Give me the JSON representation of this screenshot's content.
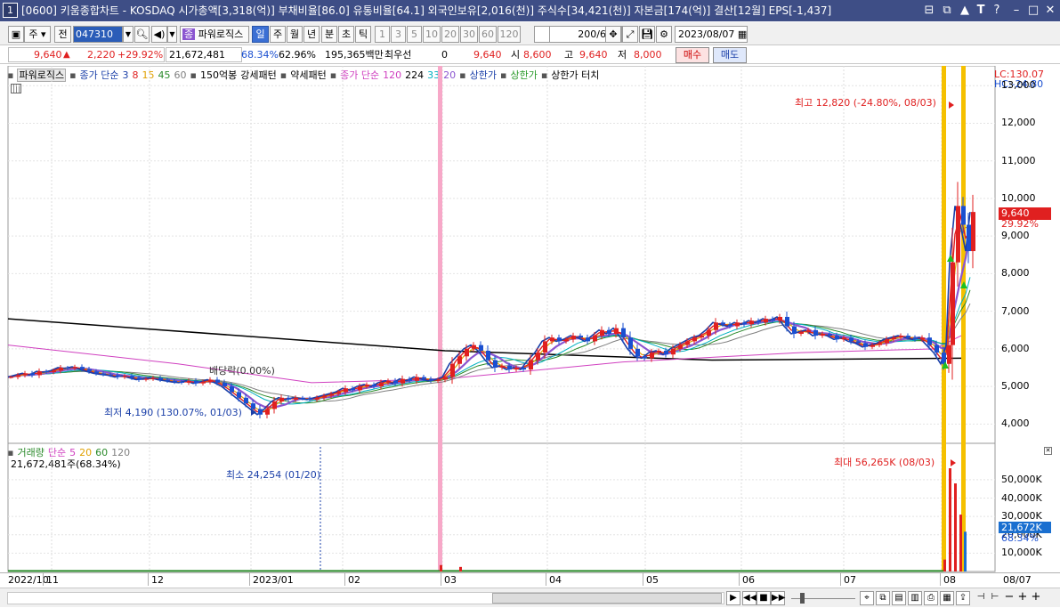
{
  "window": {
    "num": "1",
    "title": "[0600] 키움종합차트 - KOSDAQ 시가총액[3,318(억)] 부채비율[86.0] 유통비율[64.1] 외국인보유[2,016(천)] 주식수[34,421(천)] 자본금[174(억)] 결산[12월] EPS[-1,437]"
  },
  "toolbar": {
    "type_select": "주",
    "prev_label": "전",
    "code_value": "047310",
    "indicator_label": "파워로직스",
    "periods": [
      "일",
      "주",
      "월",
      "년",
      "분",
      "초",
      "틱"
    ],
    "intervals": [
      "1",
      "3",
      "5",
      "10",
      "20",
      "30",
      "60",
      "120"
    ],
    "count": "200",
    "count_total": "/600",
    "date": "2023/08/07"
  },
  "price": {
    "close": "9,640",
    "change": "2,220",
    "pct": "+29.92%",
    "volume": "21,672,481",
    "vol_ratio": "68.34%",
    "turnover": "62.96%",
    "amount": "195,365백만",
    "priority_label": "최우선",
    "priority_value": "0",
    "price2": "9,640",
    "open_label": "시",
    "open": "8,600",
    "high_label": "고",
    "high": "9,640",
    "low_label": "저",
    "low": "8,000",
    "buy": "매수",
    "sell": "매도"
  },
  "legend_main": {
    "name": "파워로직스",
    "ma_label": "종가 단순",
    "ma3": "3",
    "ma8": "8",
    "ma15": "15",
    "ma45": "45",
    "ma60": "60",
    "pattern1": "150억봉",
    "pattern2": "강세패턴",
    "pattern3": "약세패턴",
    "ma2_label": "종가 단순",
    "ma120": "120",
    "ma224": "224",
    "ma33": "33",
    "ma20": "20",
    "upper": "상한가",
    "upper2": "상한가",
    "upper_touch": "상한가 터치"
  },
  "legend_vol": {
    "name": "거래량",
    "ma_label": "단순",
    "v5": "5",
    "v20": "20",
    "v60": "60",
    "v120": "120",
    "current": "21,672,481주(68.34%)"
  },
  "annotations": {
    "high": "최고 12,820 (-24.80%, 08/03)",
    "low": "최저 4,190 (130.07%, 01/03)",
    "dividend": "배당락(0.00%)",
    "vol_max": "최대 56,265K (08/03)",
    "vol_min": "최소 24,254 (01/20)"
  },
  "right_axis": {
    "lc": "LC:130.07",
    "hc": "HC:-24.80",
    "price_ticks": [
      "13,000",
      "12,000",
      "11,000",
      "10,000",
      "9,000",
      "8,000",
      "7,000",
      "6,000",
      "5,000",
      "4,000"
    ],
    "current_price": "9,640",
    "current_pct": "29.92%",
    "vol_ticks": [
      "50,000K",
      "40,000K",
      "30,000K",
      "20,000K",
      "10,000K"
    ],
    "current_vol": "21,672K",
    "current_vol_pct": "68.34%"
  },
  "x_axis": {
    "labels": [
      "2022/10",
      "11",
      "12",
      "2023/01",
      "02",
      "03",
      "04",
      "05",
      "06",
      "07",
      "08",
      "08/07"
    ]
  },
  "colors": {
    "up": "#e02020",
    "down": "#1a4fd0",
    "title": "#3e4e86",
    "accent_yellow": "#f5c000",
    "accent_pink": "#f7a8c8"
  },
  "chart_data": {
    "type": "candlestick",
    "price_range": [
      3700,
      13100
    ],
    "volume_range": [
      0,
      56265
    ],
    "close_series": [
      [
        0,
        5250
      ],
      [
        8,
        5300
      ],
      [
        16,
        5350
      ],
      [
        24,
        5300
      ],
      [
        32,
        5400
      ],
      [
        40,
        5380
      ],
      [
        48,
        5420
      ],
      [
        56,
        5500
      ],
      [
        64,
        5480
      ],
      [
        72,
        5520
      ],
      [
        80,
        5460
      ],
      [
        88,
        5400
      ],
      [
        96,
        5350
      ],
      [
        104,
        5320
      ],
      [
        112,
        5300
      ],
      [
        120,
        5250
      ],
      [
        128,
        5280
      ],
      [
        136,
        5230
      ],
      [
        144,
        5180
      ],
      [
        152,
        5200
      ],
      [
        160,
        5230
      ],
      [
        168,
        5180
      ],
      [
        176,
        5150
      ],
      [
        184,
        5120
      ],
      [
        192,
        5100
      ],
      [
        200,
        5150
      ],
      [
        208,
        5080
      ],
      [
        216,
        5120
      ],
      [
        224,
        5180
      ],
      [
        232,
        5100
      ],
      [
        240,
        5000
      ],
      [
        248,
        4850
      ],
      [
        256,
        4700
      ],
      [
        264,
        4550
      ],
      [
        272,
        4400
      ],
      [
        280,
        4250
      ],
      [
        288,
        4400
      ],
      [
        296,
        4600
      ],
      [
        304,
        4700
      ],
      [
        312,
        4650
      ],
      [
        320,
        4700
      ],
      [
        328,
        4680
      ],
      [
        336,
        4650
      ],
      [
        344,
        4700
      ],
      [
        352,
        4750
      ],
      [
        360,
        4800
      ],
      [
        368,
        4850
      ],
      [
        376,
        4950
      ],
      [
        384,
        4900
      ],
      [
        392,
        5000
      ],
      [
        400,
        5050
      ],
      [
        408,
        5000
      ],
      [
        416,
        5100
      ],
      [
        424,
        5150
      ],
      [
        432,
        5080
      ],
      [
        440,
        5200
      ],
      [
        448,
        5150
      ],
      [
        456,
        5250
      ],
      [
        464,
        5200
      ],
      [
        472,
        5150
      ],
      [
        480,
        5180
      ],
      [
        488,
        5250
      ],
      [
        496,
        5600
      ],
      [
        504,
        5800
      ],
      [
        512,
        6000
      ],
      [
        520,
        6100
      ],
      [
        528,
        5950
      ],
      [
        536,
        5700
      ],
      [
        544,
        5500
      ],
      [
        552,
        5550
      ],
      [
        560,
        5450
      ],
      [
        568,
        5500
      ],
      [
        576,
        5450
      ],
      [
        584,
        5700
      ],
      [
        592,
        5900
      ],
      [
        600,
        6200
      ],
      [
        608,
        6300
      ],
      [
        616,
        6200
      ],
      [
        624,
        6250
      ],
      [
        632,
        6350
      ],
      [
        640,
        6300
      ],
      [
        648,
        6200
      ],
      [
        656,
        6350
      ],
      [
        664,
        6500
      ],
      [
        672,
        6400
      ],
      [
        680,
        6550
      ],
      [
        688,
        6300
      ],
      [
        696,
        6000
      ],
      [
        704,
        5800
      ],
      [
        712,
        5750
      ],
      [
        720,
        5900
      ],
      [
        728,
        5950
      ],
      [
        736,
        5850
      ],
      [
        744,
        6000
      ],
      [
        752,
        6100
      ],
      [
        760,
        6200
      ],
      [
        768,
        6300
      ],
      [
        776,
        6350
      ],
      [
        784,
        6500
      ],
      [
        792,
        6700
      ],
      [
        800,
        6650
      ],
      [
        808,
        6600
      ],
      [
        816,
        6700
      ],
      [
        824,
        6650
      ],
      [
        832,
        6750
      ],
      [
        840,
        6700
      ],
      [
        848,
        6800
      ],
      [
        856,
        6750
      ],
      [
        864,
        6850
      ],
      [
        872,
        6600
      ],
      [
        880,
        6400
      ],
      [
        888,
        6450
      ],
      [
        896,
        6500
      ],
      [
        904,
        6350
      ],
      [
        912,
        6400
      ],
      [
        920,
        6350
      ],
      [
        928,
        6250
      ],
      [
        936,
        6300
      ],
      [
        944,
        6200
      ],
      [
        952,
        6150
      ],
      [
        960,
        6050
      ],
      [
        968,
        6100
      ],
      [
        976,
        6150
      ],
      [
        984,
        6250
      ],
      [
        992,
        6300
      ],
      [
        1000,
        6350
      ],
      [
        1008,
        6300
      ],
      [
        1016,
        6250
      ],
      [
        1024,
        6300
      ],
      [
        1032,
        6100
      ],
      [
        1040,
        5900
      ],
      [
        1048,
        5600
      ],
      [
        1054,
        6100
      ],
      [
        1058,
        8300
      ],
      [
        1064,
        9800
      ],
      [
        1070,
        9300
      ],
      [
        1076,
        8600
      ],
      [
        1081,
        9640
      ]
    ],
    "volume_bars": [
      [
        494,
        3500
      ],
      [
        516,
        2500
      ],
      [
        1060,
        6500
      ],
      [
        1066,
        56265
      ],
      [
        1072,
        48000
      ],
      [
        1078,
        31000
      ],
      [
        1083,
        21672
      ]
    ]
  }
}
